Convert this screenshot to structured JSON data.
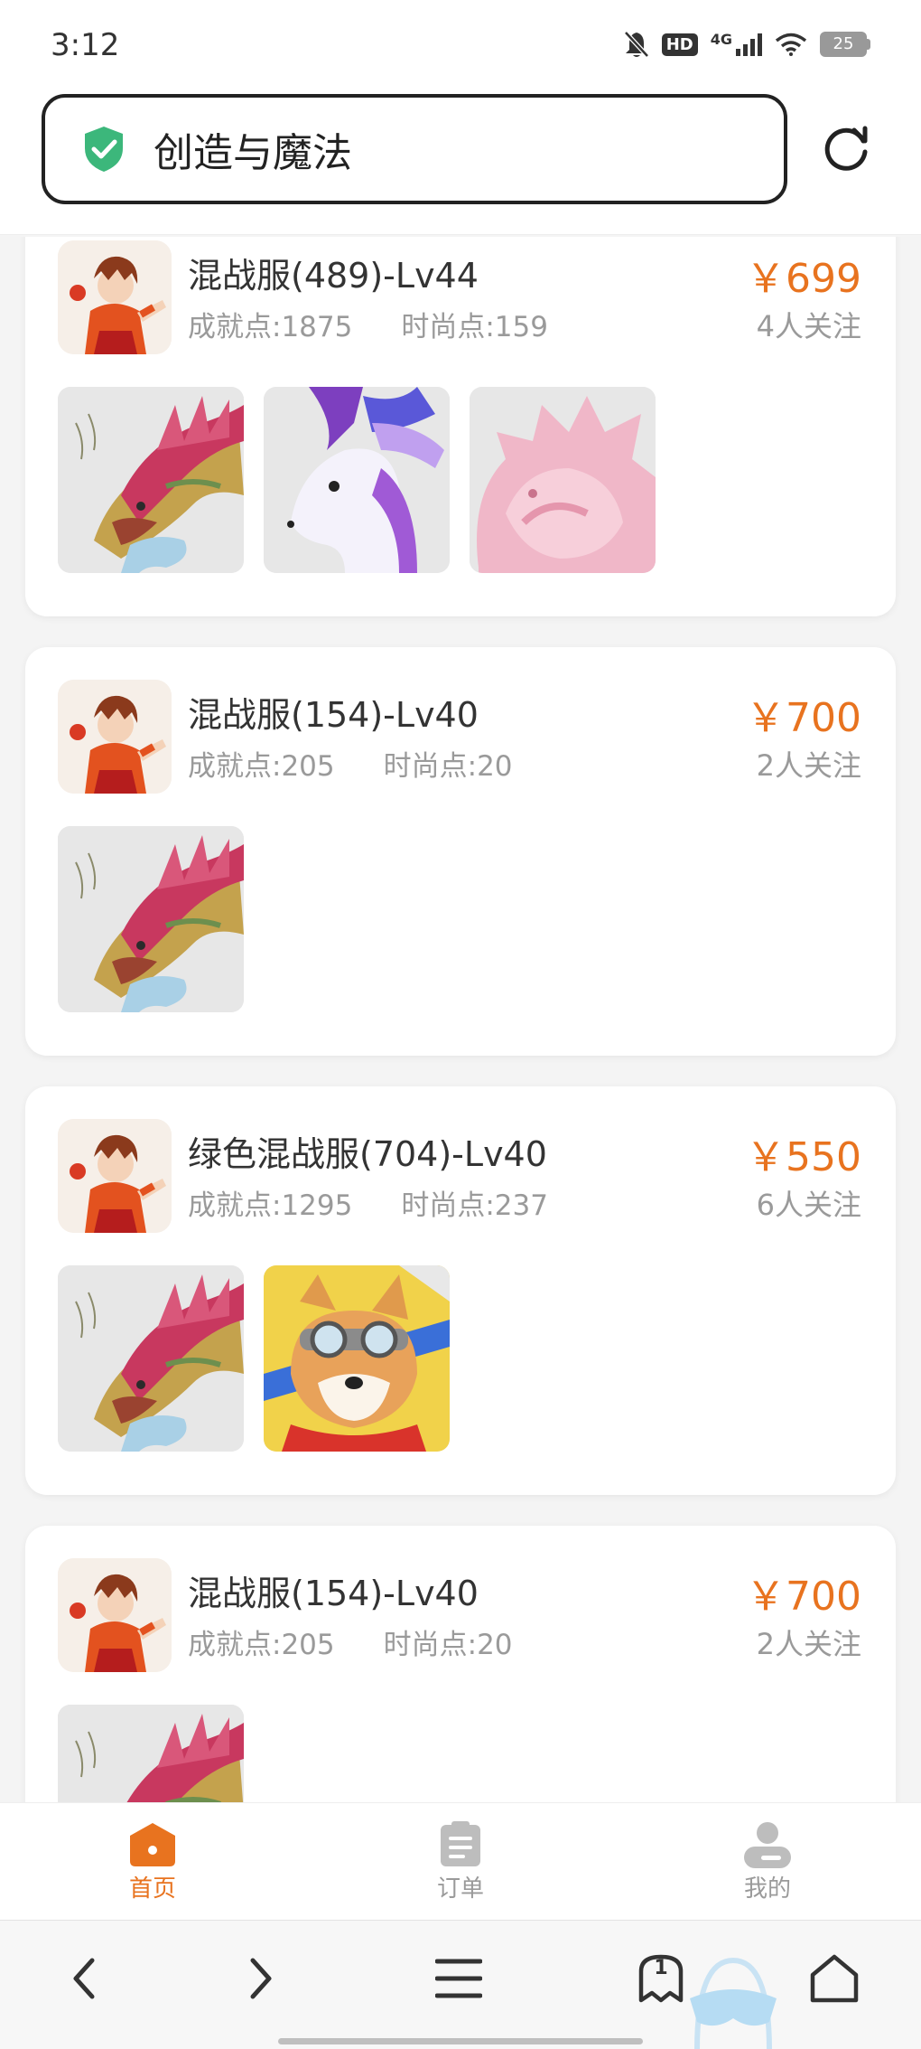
{
  "status_bar": {
    "time": "3:12",
    "network": "4G",
    "hd": "HD",
    "battery": "25"
  },
  "search": {
    "title": "创造与魔法"
  },
  "colors": {
    "accent": "#e8731f",
    "shield": "#3cb77b",
    "muted": "#9a9a9a"
  },
  "listings": [
    {
      "title": "混战服(489)-Lv44",
      "achievement": "成就点:1875",
      "fashion": "时尚点:159",
      "price": "￥699",
      "followers": "4人关注",
      "pets": [
        "dragon-pet",
        "white-deer-pet",
        "pink-beast-pet"
      ]
    },
    {
      "title": "混战服(154)-Lv40",
      "achievement": "成就点:205",
      "fashion": "时尚点:20",
      "price": "￥700",
      "followers": "2人关注",
      "pets": [
        "dragon-pet"
      ]
    },
    {
      "title": "绿色混战服(704)-Lv40",
      "achievement": "成就点:1295",
      "fashion": "时尚点:237",
      "price": "￥550",
      "followers": "6人关注",
      "pets": [
        "dragon-pet",
        "corgi-pilot-pet"
      ]
    },
    {
      "title": "混战服(154)-Lv40",
      "achievement": "成就点:205",
      "fashion": "时尚点:20",
      "price": "￥700",
      "followers": "2人关注",
      "pets": [
        "dragon-pet"
      ]
    }
  ],
  "tabbar": {
    "tabs": [
      {
        "label": "首页",
        "icon": "home-icon",
        "active": true
      },
      {
        "label": "订单",
        "icon": "clipboard-icon",
        "active": false
      },
      {
        "label": "我的",
        "icon": "person-icon",
        "active": false
      }
    ]
  },
  "browser": {
    "tab_count": "1"
  }
}
